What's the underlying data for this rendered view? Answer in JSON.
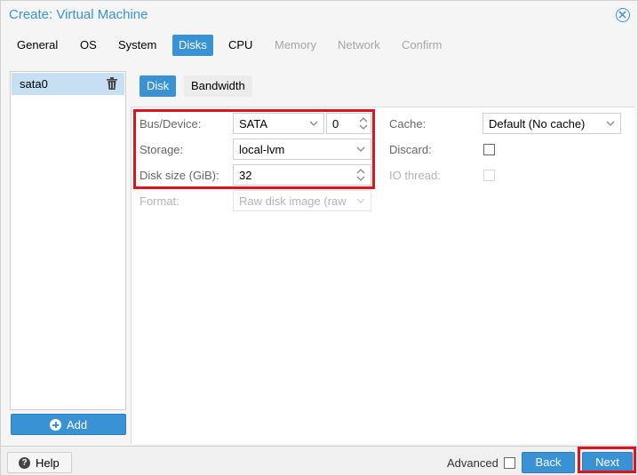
{
  "window": {
    "title": "Create: Virtual Machine"
  },
  "tabs": [
    {
      "label": "General",
      "state": "normal"
    },
    {
      "label": "OS",
      "state": "normal"
    },
    {
      "label": "System",
      "state": "normal"
    },
    {
      "label": "Disks",
      "state": "active"
    },
    {
      "label": "CPU",
      "state": "normal"
    },
    {
      "label": "Memory",
      "state": "disabled"
    },
    {
      "label": "Network",
      "state": "disabled"
    },
    {
      "label": "Confirm",
      "state": "disabled"
    }
  ],
  "disk_list": {
    "items": [
      {
        "label": "sata0",
        "selected": true
      }
    ],
    "add_label": "Add"
  },
  "subtabs": [
    {
      "label": "Disk",
      "state": "active"
    },
    {
      "label": "Bandwidth",
      "state": "inactive"
    }
  ],
  "form": {
    "bus_device": {
      "label": "Bus/Device:",
      "bus": "SATA",
      "device": "0"
    },
    "storage": {
      "label": "Storage:",
      "value": "local-lvm"
    },
    "disk_size": {
      "label": "Disk size (GiB):",
      "value": "32"
    },
    "format": {
      "label": "Format:",
      "value": "Raw disk image (raw"
    },
    "cache": {
      "label": "Cache:",
      "value": "Default (No cache)"
    },
    "discard": {
      "label": "Discard:",
      "checked": false
    },
    "io_thread": {
      "label": "IO thread:",
      "checked": false
    }
  },
  "footer": {
    "help_label": "Help",
    "advanced_label": "Advanced",
    "advanced_checked": false,
    "back_label": "Back",
    "next_label": "Next"
  },
  "colors": {
    "accent": "#3892d4",
    "highlight": "#e0121e",
    "selected_row": "#c7dff2"
  }
}
